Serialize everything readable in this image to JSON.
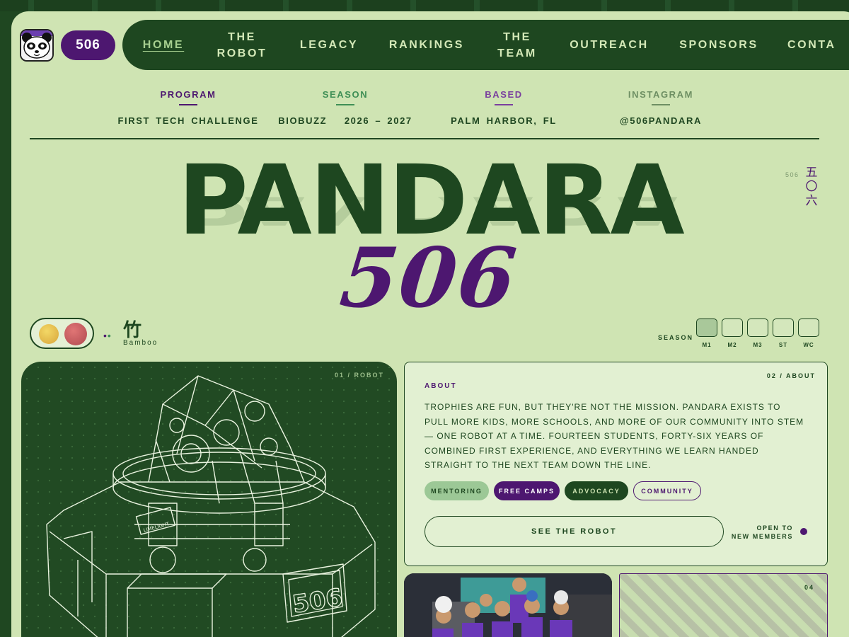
{
  "header": {
    "team_number": "506",
    "nav": [
      {
        "label": "HOME",
        "active": true
      },
      {
        "label": "THE\nROBOT"
      },
      {
        "label": "LEGACY"
      },
      {
        "label": "RANKINGS"
      },
      {
        "label": "THE\nTEAM"
      },
      {
        "label": "OUTREACH"
      },
      {
        "label": "SPONSORS"
      },
      {
        "label": "CONTA"
      }
    ]
  },
  "info": [
    {
      "key": "PROGRAM",
      "value": "FIRST TECH CHALLENGE",
      "color": "#4d1770"
    },
    {
      "key": "SEASON",
      "value": "BIOBUZZ   2026 – 2027",
      "color": "#3f8f56"
    },
    {
      "key": "BASED",
      "value": "PALM HARBOR, FL",
      "color": "#7a3f9e"
    },
    {
      "key": "INSTAGRAM",
      "value": "@506PANDARA",
      "color": "#6e8f63"
    }
  ],
  "hero": {
    "title": "PANDARA",
    "number": "506",
    "side_small": "506",
    "side_kanji": [
      "五",
      "〇",
      "六"
    ]
  },
  "bamboo": {
    "char": "竹",
    "label": "Bamboo"
  },
  "season": {
    "label": "SEASON",
    "steps": [
      {
        "label": "M1",
        "active": true
      },
      {
        "label": "M2"
      },
      {
        "label": "M3"
      },
      {
        "label": "ST"
      },
      {
        "label": "WC"
      }
    ]
  },
  "robot_card": {
    "index": "01 / ROBOT",
    "plate": "506",
    "brand": "LIMELIGHT"
  },
  "about": {
    "index": "02 / ABOUT",
    "heading": "ABOUT",
    "body": "TROPHIES ARE FUN, BUT THEY'RE NOT THE MISSION. PANDARA EXISTS TO PULL MORE KIDS, MORE SCHOOLS, AND MORE OF OUR COMMUNITY INTO STEM — ONE ROBOT AT A TIME. FOURTEEN STUDENTS, FORTY-SIX YEARS OF COMBINED FIRST EXPERIENCE, AND EVERYTHING WE LEARN HANDED STRAIGHT TO THE NEXT TEAM DOWN THE LINE.",
    "tags": [
      "MENTORING",
      "FREE CAMPS",
      "ADVOCACY",
      "COMMUNITY"
    ],
    "cta": "SEE THE ROBOT",
    "open_line1": "OPEN TO",
    "open_line2": "NEW MEMBERS"
  },
  "stripes_card": {
    "index": "04"
  },
  "colors": {
    "forest": "#1e4720",
    "purple": "#4d1770",
    "mint": "#cfe4b3"
  }
}
